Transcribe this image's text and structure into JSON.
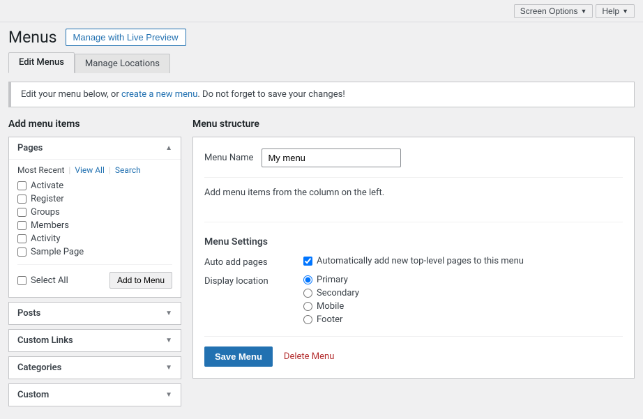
{
  "topBar": {
    "screenOptions": "Screen Options",
    "help": "Help"
  },
  "header": {
    "title": "Menus",
    "livePreview": "Manage with Live Preview"
  },
  "tabs": [
    {
      "label": "Edit Menus",
      "active": true
    },
    {
      "label": "Manage Locations",
      "active": false
    }
  ],
  "notice": {
    "text": "Edit your menu below, or ",
    "linkText": "create a new menu",
    "afterLink": ". Do not forget to save your changes!"
  },
  "leftCol": {
    "title": "Add menu items",
    "pages": {
      "label": "Pages",
      "tabs": [
        {
          "label": "Most Recent",
          "active": true
        },
        {
          "label": "View All",
          "active": false
        },
        {
          "label": "Search",
          "active": false
        }
      ],
      "items": [
        {
          "label": "Activate",
          "checked": false
        },
        {
          "label": "Register",
          "checked": false
        },
        {
          "label": "Groups",
          "checked": false
        },
        {
          "label": "Members",
          "checked": false
        },
        {
          "label": "Activity",
          "checked": false
        },
        {
          "label": "Sample Page",
          "checked": false
        }
      ],
      "selectAll": "Select All",
      "addToMenu": "Add to Menu"
    },
    "posts": {
      "label": "Posts"
    },
    "customLinks": {
      "label": "Custom Links"
    },
    "categories": {
      "label": "Categories"
    },
    "custom": {
      "label": "Custom"
    }
  },
  "rightCol": {
    "title": "Menu structure",
    "menuNameLabel": "Menu Name",
    "menuNameValue": "My menu",
    "menuHint": "Add menu items from the column on the left.",
    "settings": {
      "title": "Menu Settings",
      "autoAddLabel": "Auto add pages",
      "autoAddChecked": true,
      "autoAddText": "Automatically add new top-level pages to this menu",
      "displayLabel": "Display location",
      "locations": [
        {
          "label": "Primary",
          "checked": true
        },
        {
          "label": "Secondary",
          "checked": false
        },
        {
          "label": "Mobile",
          "checked": false
        },
        {
          "label": "Footer",
          "checked": false
        }
      ]
    },
    "saveBtn": "Save Menu",
    "deleteLink": "Delete Menu"
  }
}
